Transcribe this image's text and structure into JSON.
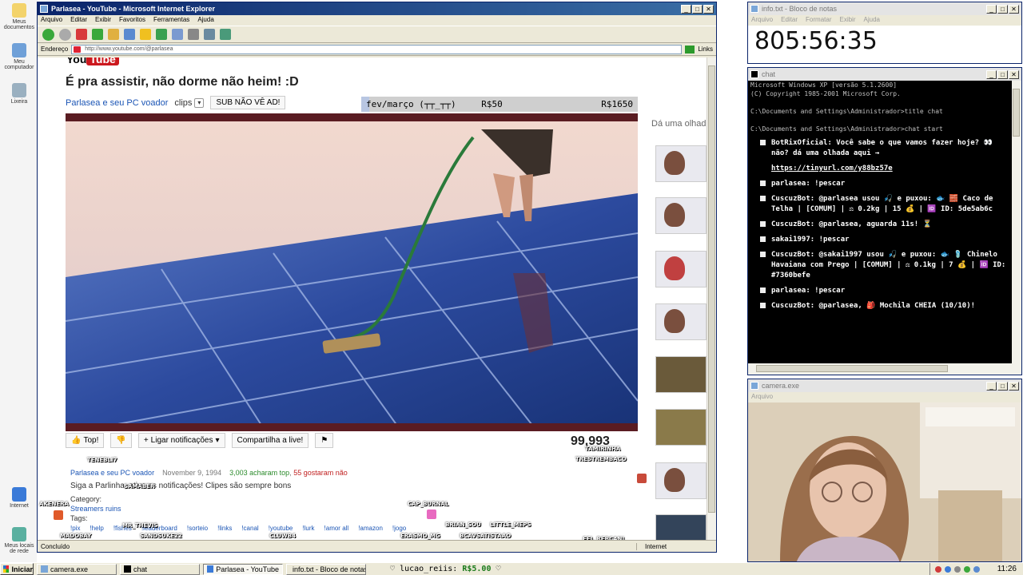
{
  "desktop": {
    "icons": [
      "Meus documentos",
      "Meu computador",
      "Lixeira",
      "Internet",
      "Meus locais de rede"
    ]
  },
  "ie": {
    "title": "Parlasea - YouTube - Microsoft Internet Explorer",
    "menu": [
      "Arquivo",
      "Editar",
      "Exibir",
      "Favoritos",
      "Ferramentas",
      "Ajuda"
    ],
    "address_label": "Endereço",
    "address": "http://www.youtube.com/@parlasea",
    "links_label": "Links",
    "status_left": "Concluído",
    "status_right": "Internet"
  },
  "youtube": {
    "logo_you": "You",
    "logo_tube": "Tube",
    "video_title": "É pra assistir, não dorme não heim! :D",
    "channel": "Parlasea e seu PC voador",
    "clips_label": "clips",
    "sub_button": "SUB NÃO VÊ AD!",
    "goal": {
      "label": "fev/março (┬┬_┬┬)",
      "current": "R$50",
      "target": "R$1650",
      "progress": 0.03
    },
    "actions": {
      "like": "Top!",
      "notify": "Ligar notificações",
      "share": "Compartilha a live!"
    },
    "view_count": "99,993",
    "meta": {
      "channel": "Parlasea e seu PC voador",
      "date": "November 9, 1994",
      "likes": "3,003 acharam top",
      "dislikes": "55 gostaram não"
    },
    "description": "Siga a Parlinha, ative as notificações! Clipes são sempre bons",
    "category_label": "Category:",
    "category": "Streamers ruins",
    "tags_label": "Tags:",
    "tags": [
      "!pix",
      "!help",
      "!fishes",
      "!leaderboard",
      "!sorteio",
      "!links",
      "!canal",
      "!youtube",
      "!lurk",
      "!amor all",
      "!amazon",
      "!jogo"
    ],
    "related_header": "Dá uma olhada"
  },
  "overlay_names": [
    "TENEBLI7",
    "SAMABER",
    "AKENERA",
    "MR_THEVIS",
    "MADOBAY",
    "SANDSUKE22",
    "CLUWB4",
    "CAP_BURNAL",
    "ERASMO_MG",
    "BRIAN_SOU",
    "LITTLE_MEPS",
    "BCAVSATISTAAO",
    "FEL_REBCANI",
    "TAMIRINHA",
    "TRESTREMBACO",
    "PARLASEA"
  ],
  "notepad": {
    "title": "info.txt - Bloco de notas",
    "menu": [
      "Arquivo",
      "Editar",
      "Formatar",
      "Exibir",
      "Ajuda"
    ],
    "timer": "805:56:35"
  },
  "chat": {
    "title": "chat",
    "console_lines": [
      "Microsoft Windows XP [versão 5.1.2600]",
      "(C) Copyright 1985-2001 Microsoft Corp.",
      "",
      "C:\\Documents and Settings\\Administrador>title chat",
      "",
      "C:\\Documents and Settings\\Administrador>chat start"
    ],
    "messages": [
      {
        "text": "BotRixOficial: Você sabe o que vamos fazer hoje? 👀 não? dá uma olhada aqui →"
      },
      {
        "text": "https://tinyurl.com/y88bz57e",
        "link": true
      },
      {
        "text": "parlasea: !pescar"
      },
      {
        "text": "CuscuzBot: @parlasea usou 🎣 e puxou: 🐟 🧱 Caco de Telha | [COMUM] | ⚖ 0.2kg | 15 💰 | 🆔 ID: 5de5ab6c"
      },
      {
        "text": "CuscuzBot: @parlasea, aguarda 11s! ⏳"
      },
      {
        "text": "sakai1997: !pescar"
      },
      {
        "text": "CuscuzBot: @sakai1997 usou 🎣 e puxou: 🐟 🩴 Chinelo Havaiana com Prego | [COMUM] | ⚖ 0.1kg | 7 💰 | 🆔 ID: #7360befe"
      },
      {
        "text": "parlasea: !pescar"
      },
      {
        "text": "CuscuzBot: @parlasea, 🎒 Mochila CHEIA (10/10)!"
      }
    ]
  },
  "camera": {
    "title": "camera.exe",
    "menu": [
      "Arquivo"
    ]
  },
  "taskbar": {
    "start": "Iniciar",
    "items": [
      "camera.exe",
      "chat",
      "Parlasea - YouTube",
      "info.txt - Bloco de notas"
    ],
    "donation_user": "lucao_reiis:",
    "donation_amount": "R$5.00",
    "clock": "11:26"
  },
  "colors": {
    "title_active": "#0a246a",
    "xp_face": "#ece9d8",
    "yt_red": "#cc181e",
    "link_blue": "#1b55b5"
  }
}
